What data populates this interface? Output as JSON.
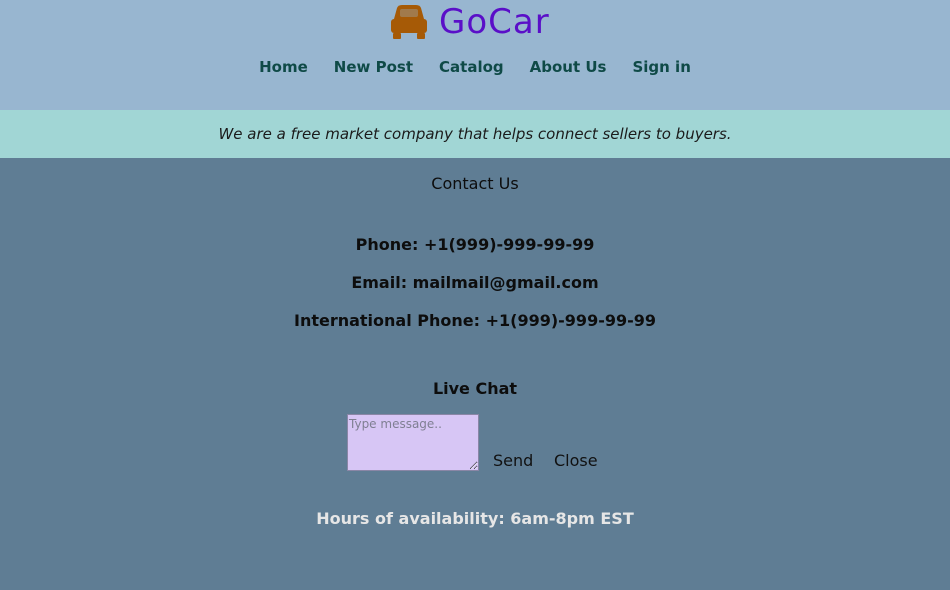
{
  "brand": {
    "name": "GoCar",
    "icon": "car-seat-icon",
    "icon_color": "#a65a06",
    "text_color": "#5a0fc8"
  },
  "nav": {
    "items": [
      "Home",
      "New Post",
      "Catalog",
      "About Us",
      "Sign in"
    ]
  },
  "banner": {
    "text": "We are a free market company that helps connect sellers to buyers."
  },
  "contact": {
    "title": "Contact Us",
    "phone": "Phone: +1(999)-999-99-99",
    "email": "Email: mailmail@gmail.com",
    "intl_phone": "International Phone: +1(999)-999-99-99"
  },
  "chat": {
    "title": "Live Chat",
    "placeholder": "Type message..",
    "send_label": "Send",
    "close_label": "Close"
  },
  "hours": {
    "text": "Hours of availability: 6am-8pm EST"
  }
}
